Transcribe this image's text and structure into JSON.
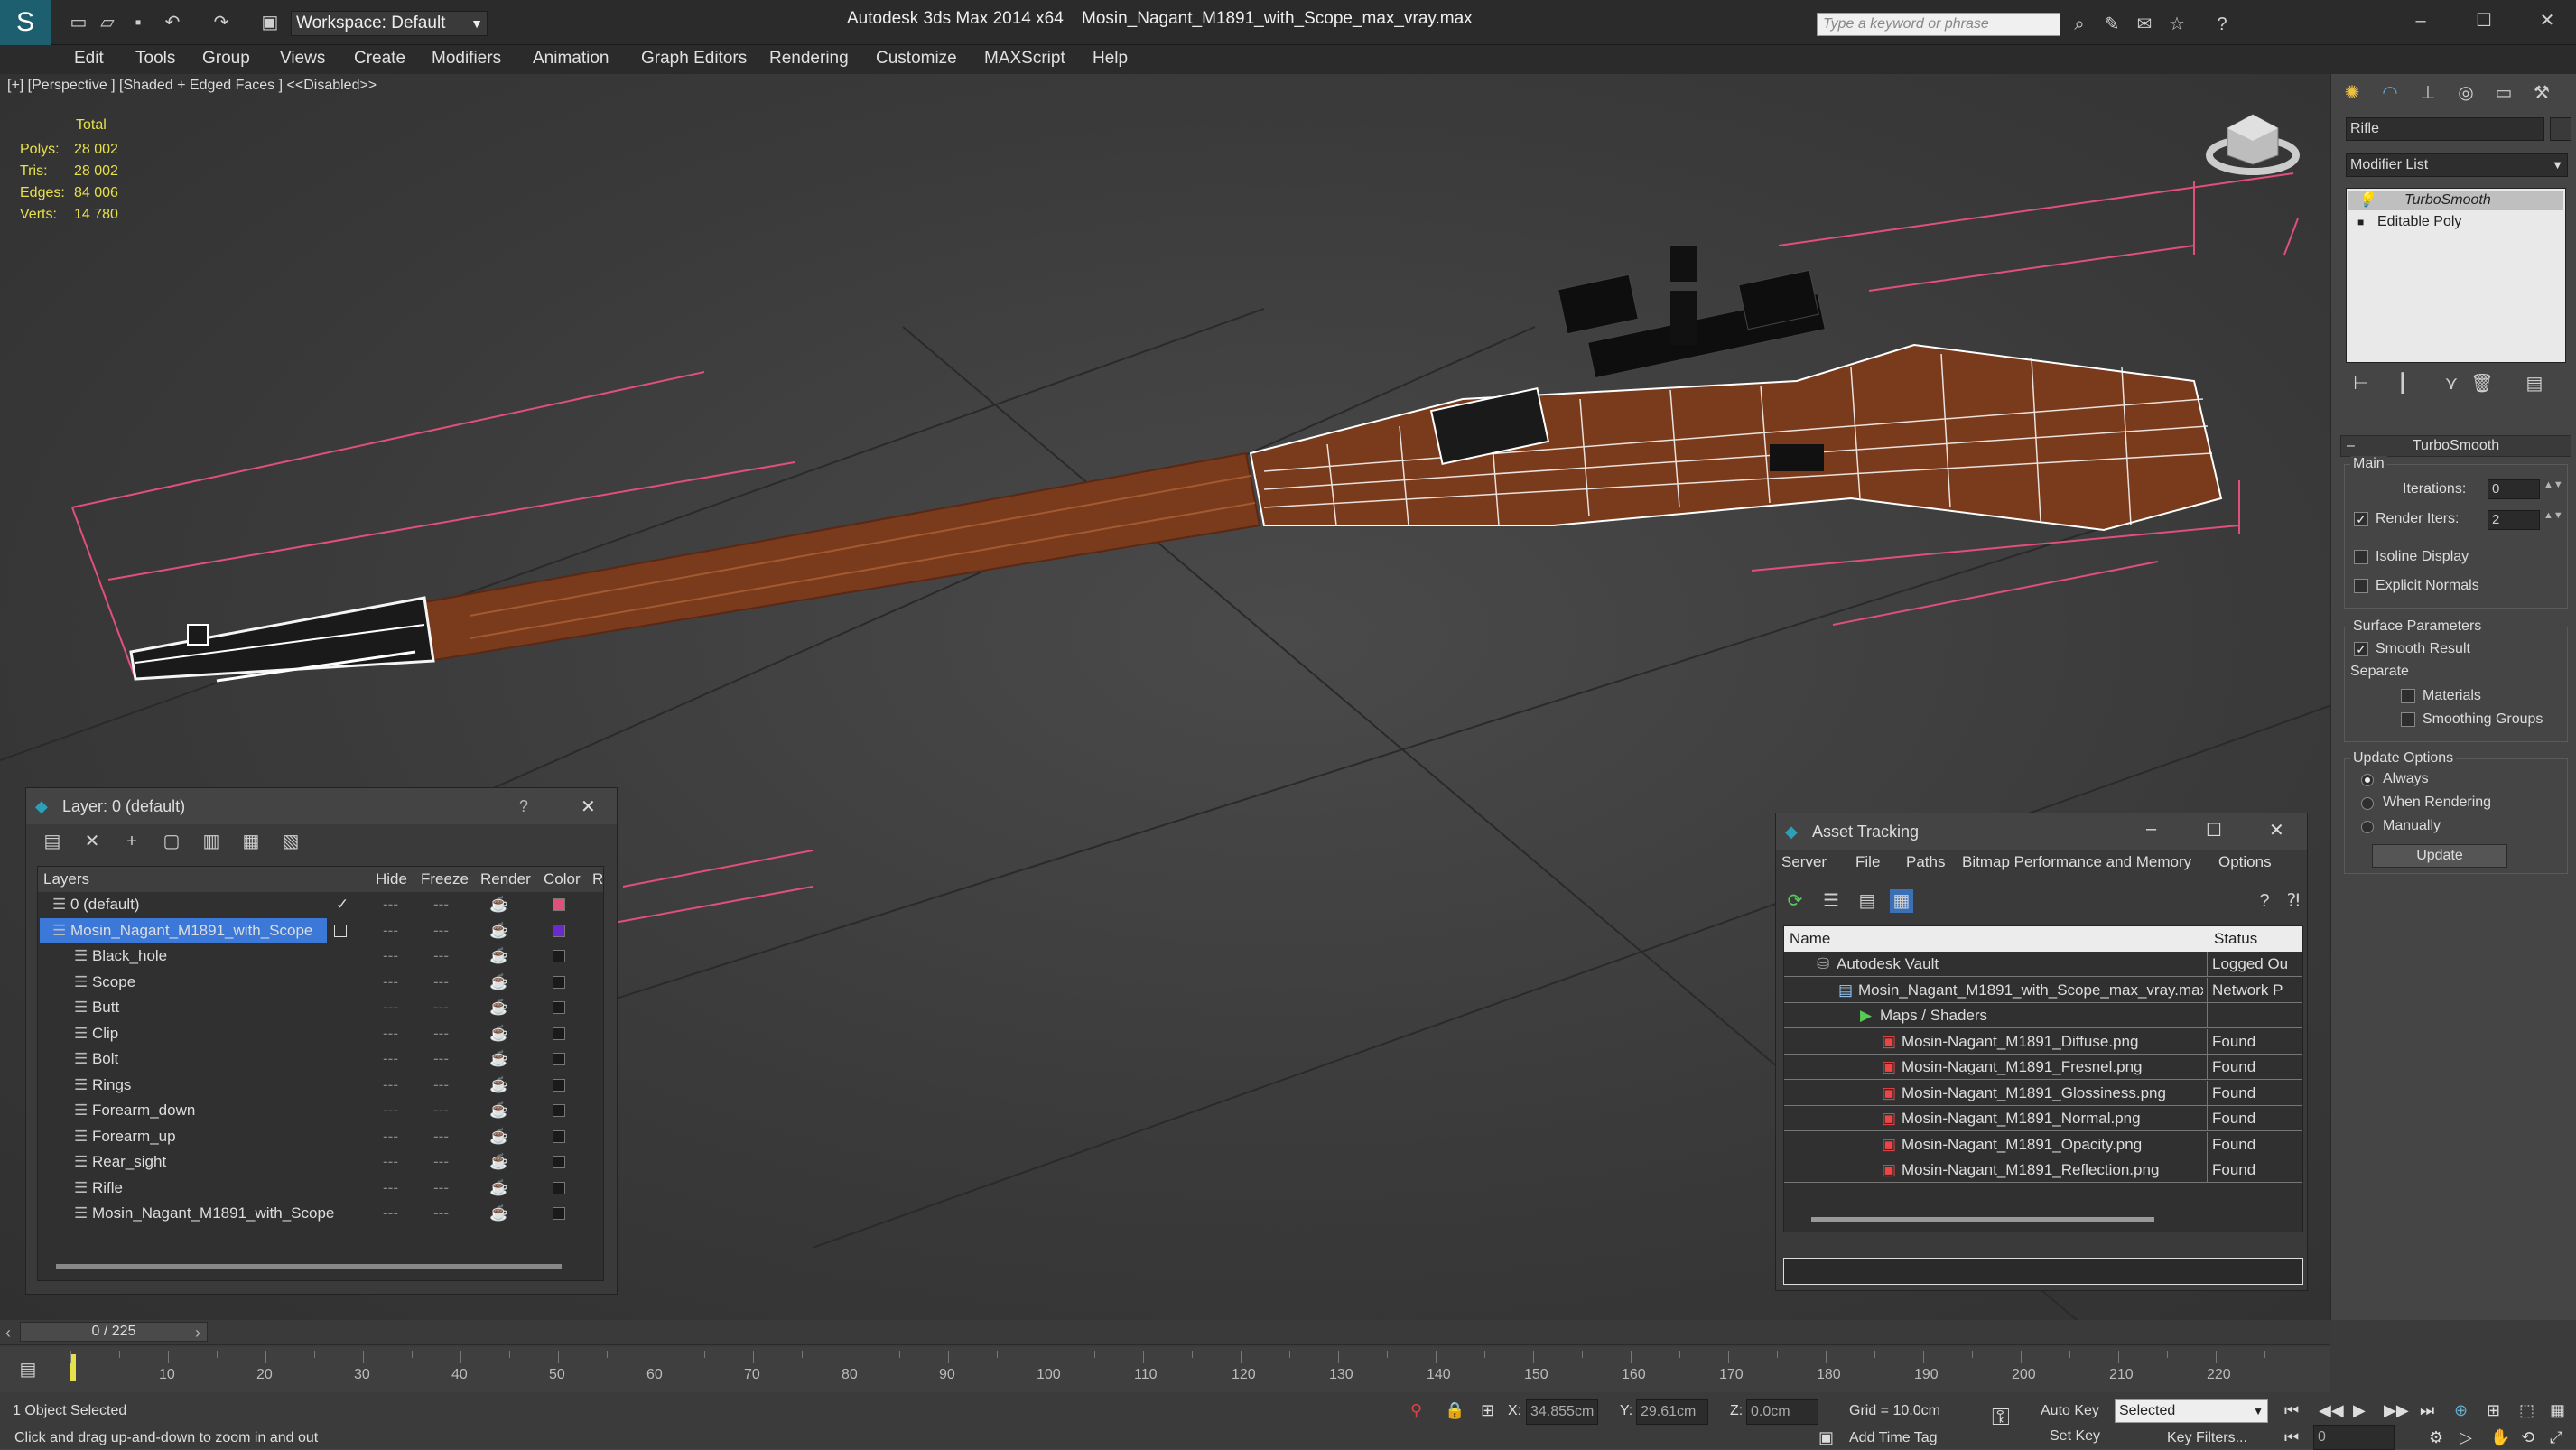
{
  "app": {
    "workspace_label": "Workspace: Default",
    "title": "Autodesk 3ds Max  2014 x64",
    "filename": "Mosin_Nagant_M1891_with_Scope_max_vray.max",
    "search_placeholder": "Type a keyword or phrase"
  },
  "menu": [
    "Edit",
    "Tools",
    "Group",
    "Views",
    "Create",
    "Modifiers",
    "Animation",
    "Graph Editors",
    "Rendering",
    "Customize",
    "MAXScript",
    "Help"
  ],
  "viewport": {
    "label": "[+] [Perspective ] [Shaded + Edged Faces ]  <<Disabled>>",
    "stats_header": "Total",
    "stats": [
      {
        "label": "Polys:",
        "value": "28 002"
      },
      {
        "label": "Tris:",
        "value": "28 002"
      },
      {
        "label": "Edges:",
        "value": "84 006"
      },
      {
        "label": "Verts:",
        "value": "14 780"
      }
    ],
    "wood_color": "#7a3a1c",
    "selection_color": "#e0507a"
  },
  "command_panel": {
    "object_name": "Rifle",
    "modifier_list": "Modifier List",
    "stack": [
      "TurboSmooth",
      "Editable Poly"
    ],
    "rollout_title": "TurboSmooth",
    "main_label": "Main",
    "iterations_label": "Iterations:",
    "iterations_value": "0",
    "render_iters_label": "Render Iters:",
    "render_iters_value": "2",
    "isoline_label": "Isoline Display",
    "explicit_normals_label": "Explicit Normals",
    "surface_params_label": "Surface Parameters",
    "smooth_result_label": "Smooth Result",
    "separate_label": "Separate",
    "materials_label": "Materials",
    "smoothing_groups_label": "Smoothing Groups",
    "update_options_label": "Update Options",
    "always_label": "Always",
    "when_rendering_label": "When Rendering",
    "manually_label": "Manually",
    "update_button": "Update"
  },
  "layer_dialog": {
    "title": "Layer: 0 (default)",
    "help": "?",
    "columns": [
      "Layers",
      "Hide",
      "Freeze",
      "Render",
      "Color",
      "R"
    ],
    "rows": [
      {
        "name": "0 (default)",
        "color": "#e0507a",
        "level": 0,
        "checked": true
      },
      {
        "name": "Mosin_Nagant_M1891_with_Scope",
        "color": "#6a2ad0",
        "level": 0,
        "selected": true
      },
      {
        "name": "Black_hole",
        "color": "#1a1a1a",
        "level": 1
      },
      {
        "name": "Scope",
        "color": "#1a1a1a",
        "level": 1
      },
      {
        "name": "Butt",
        "color": "#1a1a1a",
        "level": 1
      },
      {
        "name": "Clip",
        "color": "#1a1a1a",
        "level": 1
      },
      {
        "name": "Bolt",
        "color": "#1a1a1a",
        "level": 1
      },
      {
        "name": "Rings",
        "color": "#1a1a1a",
        "level": 1
      },
      {
        "name": "Forearm_down",
        "color": "#1a1a1a",
        "level": 1
      },
      {
        "name": "Forearm_up",
        "color": "#1a1a1a",
        "level": 1
      },
      {
        "name": "Rear_sight",
        "color": "#1a1a1a",
        "level": 1
      },
      {
        "name": "Rifle",
        "color": "#1a1a1a",
        "level": 1
      },
      {
        "name": "Mosin_Nagant_M1891_with_Scope",
        "color": "#1a1a1a",
        "level": 1
      }
    ]
  },
  "asset_dialog": {
    "title": "Asset Tracking",
    "menu": [
      "Server",
      "File",
      "Paths",
      "Bitmap Performance and Memory",
      "Options"
    ],
    "columns": [
      "Name",
      "Status"
    ],
    "rows": [
      {
        "name": "Autodesk Vault",
        "status": "Logged Ou",
        "level": 1
      },
      {
        "name": "Mosin_Nagant_M1891_with_Scope_max_vray.max",
        "status": "Network P",
        "level": 2
      },
      {
        "name": "Maps / Shaders",
        "status": "",
        "level": 3
      },
      {
        "name": "Mosin-Nagant_M1891_Diffuse.png",
        "status": "Found",
        "level": 4
      },
      {
        "name": "Mosin-Nagant_M1891_Fresnel.png",
        "status": "Found",
        "level": 4
      },
      {
        "name": "Mosin-Nagant_M1891_Glossiness.png",
        "status": "Found",
        "level": 4
      },
      {
        "name": "Mosin-Nagant_M1891_Normal.png",
        "status": "Found",
        "level": 4
      },
      {
        "name": "Mosin-Nagant_M1891_Opacity.png",
        "status": "Found",
        "level": 4
      },
      {
        "name": "Mosin-Nagant_M1891_Reflection.png",
        "status": "Found",
        "level": 4
      }
    ]
  },
  "timeline": {
    "frame_counter": "0 / 225",
    "ticks": [
      "10",
      "20",
      "30",
      "40",
      "50",
      "60",
      "70",
      "80",
      "90",
      "100",
      "110",
      "120",
      "130",
      "140",
      "150",
      "160",
      "170",
      "180",
      "190",
      "200",
      "210",
      "220"
    ],
    "status_selected": "1 Object Selected",
    "prompt": "Click and drag up-and-down to zoom in and out",
    "x_label": "X:",
    "x_value": "34.855cm",
    "y_label": "Y:",
    "y_value": "29.61cm",
    "z_label": "Z:",
    "z_value": "0.0cm",
    "grid": "Grid = 10.0cm",
    "add_time_tag": "Add Time Tag",
    "auto_key": "Auto Key",
    "set_key": "Set Key",
    "selected_dropdown": "Selected",
    "key_filters": "Key Filters...",
    "frame_value": "0"
  }
}
